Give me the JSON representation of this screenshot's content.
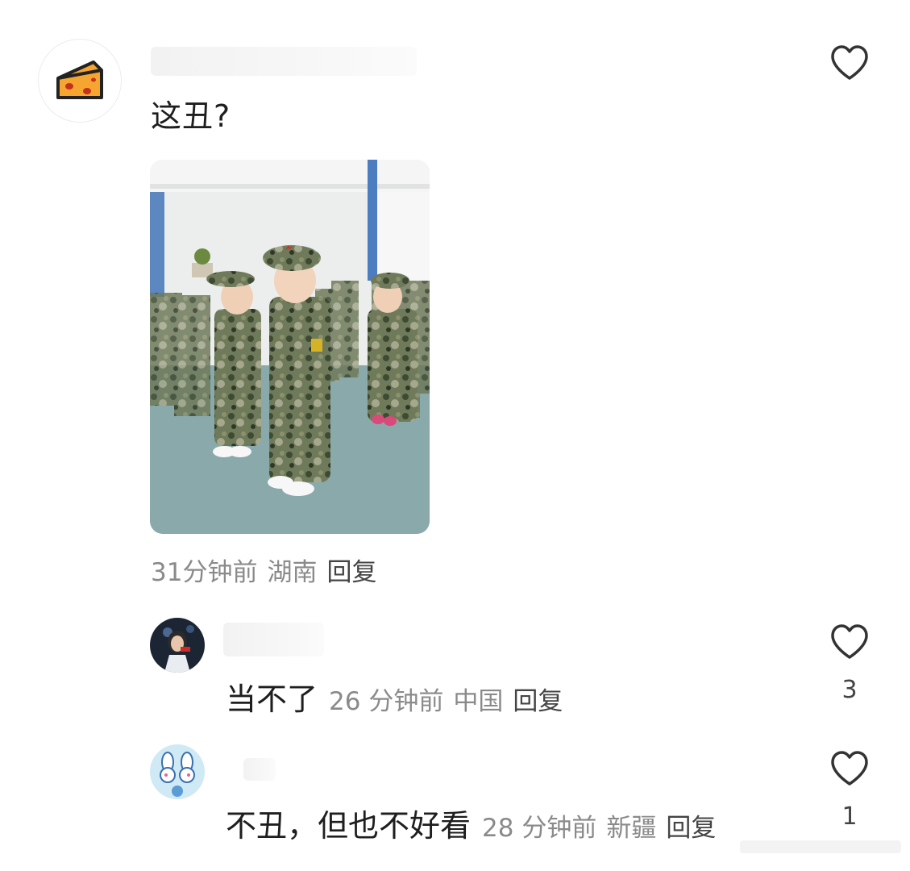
{
  "comment": {
    "text": "这丑?",
    "time": "31分钟前",
    "location": "湖南",
    "reply_label": "回复"
  },
  "replies": [
    {
      "text": "当不了",
      "time": "26 分钟前",
      "location": "中国",
      "reply_label": "回复",
      "likes": "3"
    },
    {
      "text": "不丑，但也不好看",
      "time": "28 分钟前",
      "location": "新疆",
      "reply_label": "回复",
      "likes": "1"
    }
  ],
  "icons": {
    "main_avatar": "cheese-icon",
    "like": "heart-outline-icon"
  },
  "colors": {
    "meta_text": "#8a8a8a",
    "body_text": "#1e1e1e",
    "cheese": "#f6a531"
  }
}
